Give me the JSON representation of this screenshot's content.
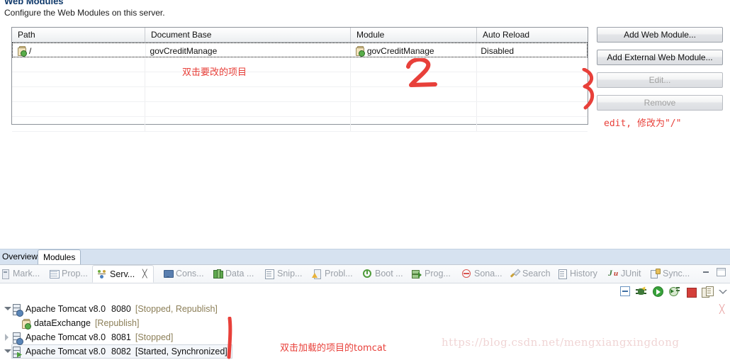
{
  "editor": {
    "section_title": "Web Modules",
    "section_description": "Configure the Web Modules on this server.",
    "table": {
      "columns": [
        "Path",
        "Document Base",
        "Module",
        "Auto Reload"
      ],
      "rows": [
        {
          "path": "/",
          "document_base": "govCreditManage",
          "module": "govCreditManage",
          "auto_reload": "Disabled",
          "selected": true
        }
      ],
      "empty_row_count": 5
    },
    "buttons": {
      "add_web_module": "Add Web Module...",
      "add_external_web_module": "Add External Web Module...",
      "edit": "Edit...",
      "remove": "Remove"
    },
    "tabs": [
      {
        "label": "Overview",
        "active": false
      },
      {
        "label": "Modules",
        "active": true
      }
    ]
  },
  "annotations": {
    "double_click_item": "双击要改的项目",
    "step_two": "2",
    "edit_note": "edit, 修改为\"/\"",
    "double_click_tomcat": "双击加载的项目的tomcat",
    "watermark": "https://blog.csdn.net/mengxiangxingdong",
    "colors": {
      "ink": "#e8403a",
      "watermark": "#f0d5d5"
    }
  },
  "views": {
    "tabs": [
      {
        "label": "Mark...",
        "icon": "marker-icon",
        "active": false,
        "closable": false
      },
      {
        "label": "Prop...",
        "icon": "properties-icon",
        "active": false,
        "closable": false
      },
      {
        "label": "Serv...",
        "icon": "servers-icon",
        "active": true,
        "closable": true
      },
      {
        "label": "Cons...",
        "icon": "console-icon",
        "active": false,
        "closable": false
      },
      {
        "label": "Data ...",
        "icon": "data-source-icon",
        "active": false,
        "closable": false
      },
      {
        "label": "Snip...",
        "icon": "snippets-icon",
        "active": false,
        "closable": false
      },
      {
        "label": "Probl...",
        "icon": "problems-icon",
        "active": false,
        "closable": false
      },
      {
        "label": "Boot ...",
        "icon": "boot-dashboard-icon",
        "active": false,
        "closable": false
      },
      {
        "label": "Prog...",
        "icon": "progress-icon",
        "active": false,
        "closable": false
      },
      {
        "label": "Sona...",
        "icon": "sonarlint-icon",
        "active": false,
        "closable": false
      },
      {
        "label": "Search",
        "icon": "search-icon",
        "active": false,
        "closable": false
      },
      {
        "label": "History",
        "icon": "history-icon",
        "active": false,
        "closable": false
      },
      {
        "label": "JUnit",
        "icon": "junit-icon",
        "active": false,
        "closable": false
      },
      {
        "label": "Sync...",
        "icon": "synchronize-icon",
        "active": false,
        "closable": false
      }
    ],
    "toolbar_icons": [
      "collapse-all-icon",
      "debug-icon",
      "run-icon",
      "profile-icon",
      "stop-icon",
      "publish-icon",
      "view-menu-icon"
    ],
    "window_icons": [
      "minimize-icon",
      "maximize-icon"
    ]
  },
  "servers": [
    {
      "name": "Apache Tomcat v8.0",
      "port": "8080",
      "state": "[Stopped, Republish]",
      "expanded": true,
      "selected": false,
      "running": false,
      "indent": 0,
      "icon": "server-icon"
    },
    {
      "name": "dataExchange",
      "port": "",
      "state": "[Republish]",
      "expanded": false,
      "selected": false,
      "running": false,
      "indent": 1,
      "icon": "web-module-icon"
    },
    {
      "name": "Apache Tomcat v8.0",
      "port": "8081",
      "state": "[Stopped]",
      "expanded": false,
      "selected": false,
      "running": false,
      "indent": 0,
      "icon": "server-icon"
    },
    {
      "name": "Apache Tomcat v8.0",
      "port": "8082",
      "state": "[Started, Synchronized]",
      "expanded": true,
      "selected": true,
      "running": true,
      "indent": 0,
      "icon": "server-icon"
    }
  ]
}
